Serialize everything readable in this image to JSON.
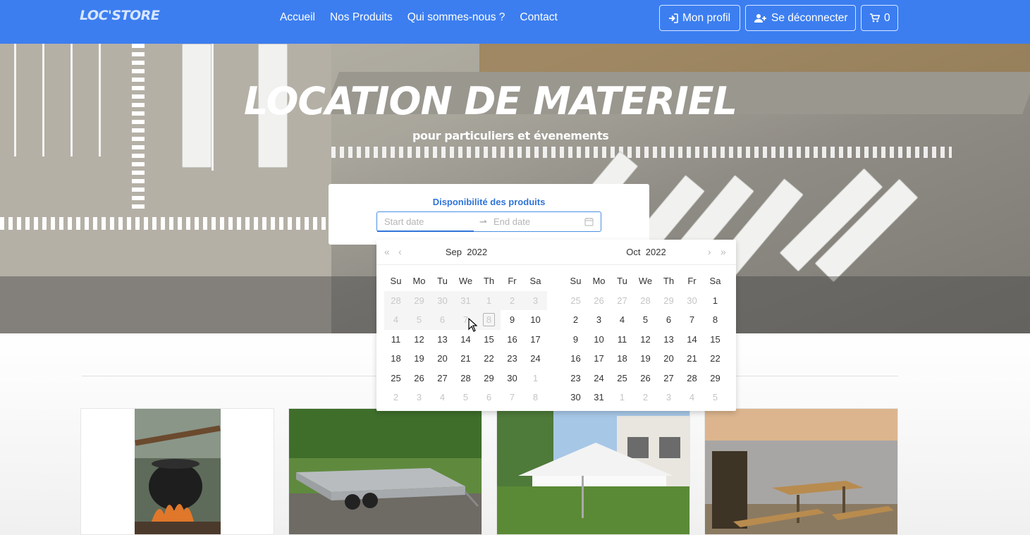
{
  "navbar": {
    "logo": "LOC'STORE",
    "links": [
      "Accueil",
      "Nos Produits",
      "Qui sommes-nous ?",
      "Contact"
    ],
    "profile_label": "Mon profil",
    "logout_label": "Se déconnecter",
    "cart_count": "0",
    "bg_color": "#3c7ef0"
  },
  "hero": {
    "title": "LOCATION DE MATERIEL",
    "subtitle": "pour particuliers et évenements"
  },
  "availability": {
    "title": "Disponibilité des produits",
    "start_placeholder": "Start date",
    "end_placeholder": "End date",
    "separator": "⇀"
  },
  "calendar": {
    "weekdays": [
      "Su",
      "Mo",
      "Tu",
      "We",
      "Th",
      "Fr",
      "Sa"
    ],
    "left": {
      "month": "Sep",
      "year": "2022",
      "weeks": [
        [
          "28",
          "29",
          "30",
          "31",
          "1",
          "2",
          "3"
        ],
        [
          "4",
          "5",
          "6",
          "7",
          "8",
          "9",
          "10"
        ],
        [
          "11",
          "12",
          "13",
          "14",
          "15",
          "16",
          "17"
        ],
        [
          "18",
          "19",
          "20",
          "21",
          "22",
          "23",
          "24"
        ],
        [
          "25",
          "26",
          "27",
          "28",
          "29",
          "30",
          "1"
        ],
        [
          "2",
          "3",
          "4",
          "5",
          "6",
          "7",
          "8"
        ]
      ]
    },
    "right": {
      "month": "Oct",
      "year": "2022",
      "weeks": [
        [
          "25",
          "26",
          "27",
          "28",
          "29",
          "30",
          "1"
        ],
        [
          "2",
          "3",
          "4",
          "5",
          "6",
          "7",
          "8"
        ],
        [
          "9",
          "10",
          "11",
          "12",
          "13",
          "14",
          "15"
        ],
        [
          "16",
          "17",
          "18",
          "19",
          "20",
          "21",
          "22"
        ],
        [
          "23",
          "24",
          "25",
          "26",
          "27",
          "28",
          "29"
        ],
        [
          "30",
          "31",
          "1",
          "2",
          "3",
          "4",
          "5"
        ]
      ]
    }
  },
  "products": [
    {
      "image": "cauldron-over-fire"
    },
    {
      "image": "trailer"
    },
    {
      "image": "white-tent"
    },
    {
      "image": "picnic-table-by-lake"
    }
  ]
}
